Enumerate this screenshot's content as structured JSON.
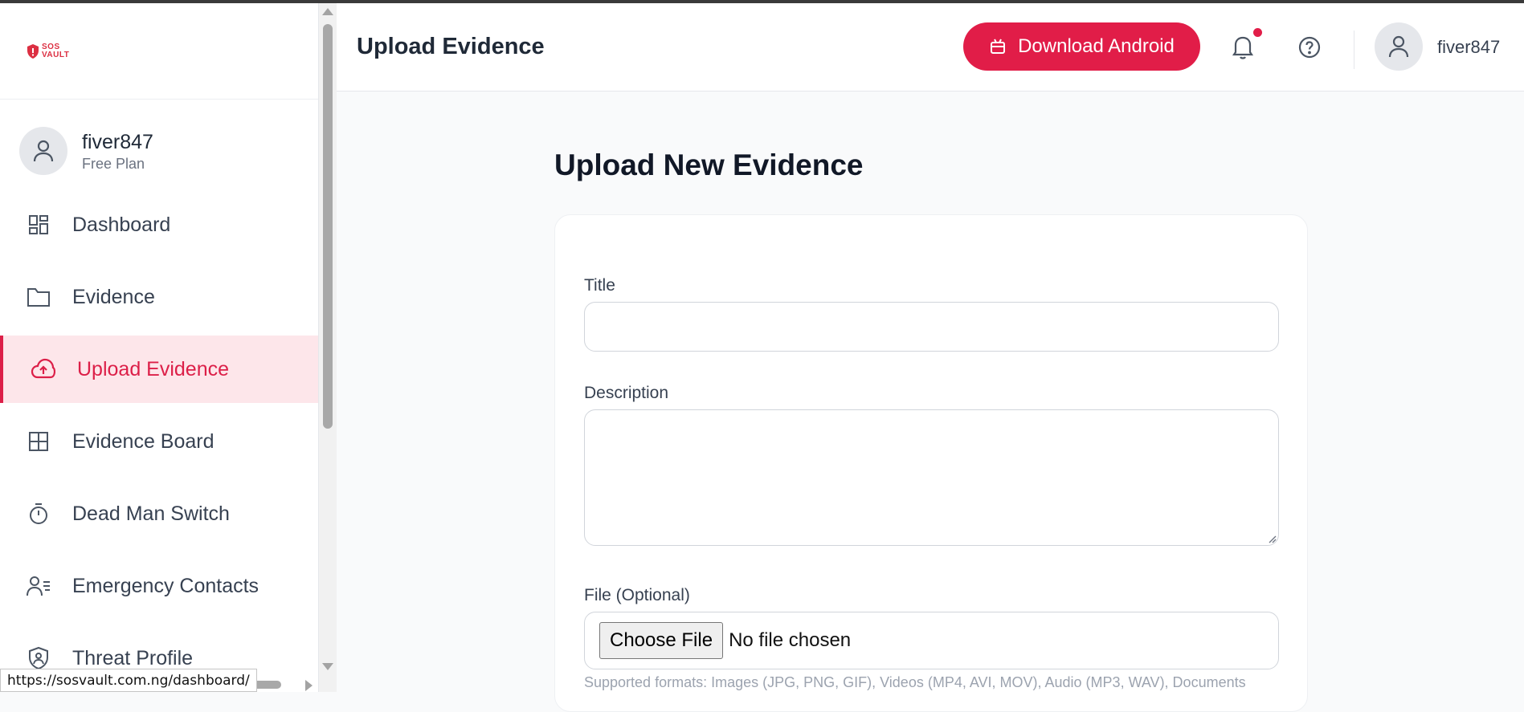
{
  "brand": {
    "logo_line1": "SOS",
    "logo_line2": "VAULT"
  },
  "user": {
    "name": "fiver847",
    "plan": "Free Plan"
  },
  "sidebar": {
    "items": [
      {
        "label": "Dashboard",
        "icon": "dashboard-icon"
      },
      {
        "label": "Evidence",
        "icon": "folder-icon"
      },
      {
        "label": "Upload Evidence",
        "icon": "cloud-upload-icon",
        "active": true
      },
      {
        "label": "Evidence Board",
        "icon": "grid-icon"
      },
      {
        "label": "Dead Man Switch",
        "icon": "timer-icon"
      },
      {
        "label": "Emergency Contacts",
        "icon": "contacts-icon"
      },
      {
        "label": "Threat Profile",
        "icon": "shield-user-icon"
      }
    ]
  },
  "header": {
    "title": "Upload Evidence",
    "download_label": "Download Android",
    "username": "fiver847"
  },
  "main": {
    "heading": "Upload New Evidence",
    "form": {
      "title_label": "Title",
      "title_value": "",
      "description_label": "Description",
      "description_value": "",
      "file_label": "File (Optional)",
      "choose_file_label": "Choose File",
      "no_file_text": "No file chosen",
      "supported_formats": "Supported formats: Images (JPG, PNG, GIF), Videos (MP4, AVI, MOV), Audio (MP3, WAV), Documents"
    }
  },
  "status_bar": {
    "url": "https://sosvault.com.ng/dashboard/"
  },
  "colors": {
    "accent": "#e11d48",
    "active_bg": "#fde6ea",
    "notification_dot": "#e11d48"
  }
}
